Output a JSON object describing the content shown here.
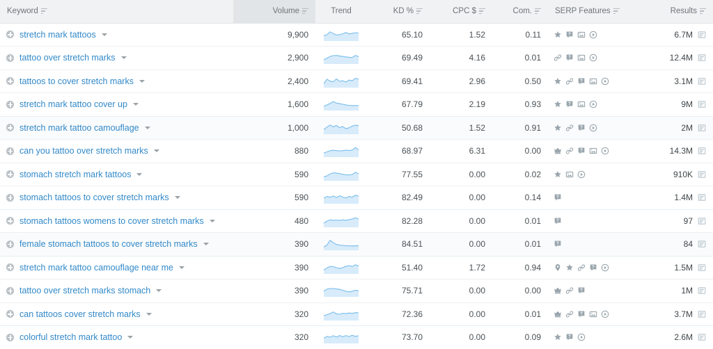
{
  "table": {
    "columns": [
      {
        "key": "keyword",
        "label": "Keyword",
        "align": "left",
        "highlight": false,
        "sortable": true
      },
      {
        "key": "volume",
        "label": "Volume",
        "align": "right",
        "highlight": true,
        "sortable": true
      },
      {
        "key": "trend",
        "label": "Trend",
        "align": "center",
        "highlight": false,
        "sortable": false
      },
      {
        "key": "kd",
        "label": "KD %",
        "align": "right",
        "highlight": false,
        "sortable": true
      },
      {
        "key": "cpc",
        "label": "CPC $",
        "align": "right",
        "highlight": false,
        "sortable": true
      },
      {
        "key": "com",
        "label": "Com.",
        "align": "right",
        "highlight": false,
        "sortable": true
      },
      {
        "key": "serp",
        "label": "SERP Features",
        "align": "left",
        "highlight": false,
        "sortable": true
      },
      {
        "key": "results",
        "label": "Results",
        "align": "right",
        "highlight": false,
        "sortable": true
      }
    ],
    "rows": [
      {
        "keyword": "stretch mark tattoos",
        "volume": "9,900",
        "kd": "65.10",
        "cpc": "1.52",
        "com": "0.11",
        "serp": [
          "star",
          "faq",
          "image",
          "video"
        ],
        "results": "6.7M",
        "trend": [
          0.42,
          0.5,
          0.78,
          0.62,
          0.48,
          0.52,
          0.6,
          0.72,
          0.58,
          0.64,
          0.7,
          0.66
        ]
      },
      {
        "keyword": "tattoo over stretch marks",
        "volume": "2,900",
        "kd": "69.49",
        "cpc": "4.16",
        "com": "0.01",
        "serp": [
          "link",
          "faq",
          "image",
          "video"
        ],
        "results": "12.4M",
        "trend": [
          0.3,
          0.46,
          0.62,
          0.7,
          0.72,
          0.66,
          0.62,
          0.58,
          0.54,
          0.52,
          0.72,
          0.6
        ]
      },
      {
        "keyword": "tattoos to cover stretch marks",
        "volume": "2,400",
        "kd": "69.41",
        "cpc": "2.96",
        "com": "0.50",
        "serp": [
          "star",
          "link",
          "faq",
          "image",
          "video"
        ],
        "results": "3.1M",
        "trend": [
          0.28,
          0.7,
          0.52,
          0.46,
          0.74,
          0.5,
          0.56,
          0.44,
          0.62,
          0.56,
          0.8,
          0.72
        ]
      },
      {
        "keyword": "stretch mark tattoo cover up",
        "volume": "1,600",
        "kd": "67.79",
        "cpc": "2.19",
        "com": "0.93",
        "serp": [
          "star",
          "faq",
          "image",
          "video"
        ],
        "results": "9M",
        "trend": [
          0.3,
          0.44,
          0.58,
          0.76,
          0.62,
          0.56,
          0.5,
          0.44,
          0.4,
          0.38,
          0.38,
          0.38
        ]
      },
      {
        "keyword": "stretch mark tattoo camouflage",
        "volume": "1,000",
        "kd": "50.68",
        "cpc": "1.52",
        "com": "0.91",
        "serp": [
          "star",
          "link",
          "faq",
          "video"
        ],
        "results": "2M",
        "trend": [
          0.34,
          0.58,
          0.78,
          0.6,
          0.74,
          0.52,
          0.64,
          0.42,
          0.52,
          0.68,
          0.76,
          0.72
        ]
      },
      {
        "keyword": "can you tattoo over stretch marks",
        "volume": "880",
        "kd": "68.97",
        "cpc": "6.31",
        "com": "0.00",
        "serp": [
          "crown",
          "link",
          "faq",
          "image",
          "video"
        ],
        "results": "14.3M",
        "trend": [
          0.3,
          0.4,
          0.52,
          0.56,
          0.52,
          0.5,
          0.52,
          0.56,
          0.54,
          0.58,
          0.82,
          0.6
        ]
      },
      {
        "keyword": "stomach stretch mark tattoos",
        "volume": "590",
        "kd": "77.55",
        "cpc": "0.00",
        "com": "0.02",
        "serp": [
          "star",
          "image",
          "video"
        ],
        "results": "910K",
        "trend": [
          0.3,
          0.36,
          0.56,
          0.66,
          0.64,
          0.58,
          0.52,
          0.48,
          0.46,
          0.5,
          0.72,
          0.56
        ]
      },
      {
        "keyword": "stomach tattoos to cover stretch marks",
        "volume": "590",
        "kd": "82.49",
        "cpc": "0.00",
        "com": "0.14",
        "serp": [
          "faq"
        ],
        "results": "1.4M",
        "trend": [
          0.42,
          0.6,
          0.52,
          0.64,
          0.5,
          0.66,
          0.54,
          0.44,
          0.6,
          0.52,
          0.72,
          0.62
        ]
      },
      {
        "keyword": "stomach tattoos womens to cover stretch marks",
        "volume": "480",
        "kd": "82.28",
        "cpc": "0.00",
        "com": "0.01",
        "serp": [
          "faq"
        ],
        "results": "97",
        "trend": [
          0.3,
          0.5,
          0.62,
          0.58,
          0.6,
          0.56,
          0.62,
          0.58,
          0.64,
          0.7,
          0.82,
          0.7
        ]
      },
      {
        "keyword": "female stomach tattoos to cover stretch marks",
        "volume": "390",
        "kd": "84.51",
        "cpc": "0.00",
        "com": "0.01",
        "serp": [
          "faq"
        ],
        "results": "84",
        "trend": [
          0.22,
          0.4,
          0.86,
          0.62,
          0.46,
          0.4,
          0.36,
          0.34,
          0.33,
          0.32,
          0.34,
          0.33
        ]
      },
      {
        "keyword": "stretch mark tattoo camouflage near me",
        "volume": "390",
        "kd": "51.40",
        "cpc": "1.72",
        "com": "0.94",
        "serp": [
          "map",
          "star",
          "link",
          "faq",
          "video"
        ],
        "results": "1.5M",
        "trend": [
          0.26,
          0.48,
          0.62,
          0.6,
          0.5,
          0.42,
          0.5,
          0.64,
          0.7,
          0.62,
          0.78,
          0.66
        ]
      },
      {
        "keyword": "tattoo over stretch marks stomach",
        "volume": "390",
        "kd": "75.71",
        "cpc": "0.00",
        "com": "0.00",
        "serp": [
          "crown",
          "link",
          "faq"
        ],
        "results": "1M",
        "trend": [
          0.44,
          0.64,
          0.7,
          0.7,
          0.66,
          0.62,
          0.54,
          0.44,
          0.38,
          0.44,
          0.54,
          0.48
        ]
      },
      {
        "keyword": "can tattoos cover stretch marks",
        "volume": "320",
        "kd": "72.36",
        "cpc": "0.00",
        "com": "0.01",
        "serp": [
          "crown",
          "link",
          "faq",
          "image",
          "video"
        ],
        "results": "3.7M",
        "trend": [
          0.36,
          0.46,
          0.56,
          0.72,
          0.54,
          0.5,
          0.6,
          0.56,
          0.62,
          0.58,
          0.66,
          0.62
        ]
      },
      {
        "keyword": "colorful stretch mark tattoo",
        "volume": "320",
        "kd": "73.70",
        "cpc": "0.00",
        "com": "0.09",
        "serp": [
          "star",
          "faq",
          "video"
        ],
        "results": "2.6M",
        "trend": [
          0.4,
          0.58,
          0.5,
          0.64,
          0.52,
          0.66,
          0.54,
          0.66,
          0.56,
          0.68,
          0.58,
          0.64
        ]
      }
    ]
  },
  "icons": {
    "serp_labels": {
      "star": "star-icon",
      "link": "sitelinks-link-icon",
      "faq": "faq-question-icon",
      "image": "image-pack-icon",
      "video": "video-play-icon",
      "crown": "featured-snippet-crown-icon",
      "map": "local-pack-map-pin-icon"
    },
    "results_icon": "serp-report-icon",
    "expand_icon": "add-keyword-plus-icon",
    "dropdown_icon": "keyword-dropdown-caret-icon",
    "sort_icon": "sort-filter-icon"
  },
  "colors": {
    "link": "#3289c9",
    "header_bg": "#f1f2f3",
    "header_highlight_bg": "#e2e5e7",
    "spark_line": "#79bdec",
    "spark_fill": "#d7ebfa",
    "icon_grey": "#9aa6ad",
    "text": "#3f4549"
  }
}
